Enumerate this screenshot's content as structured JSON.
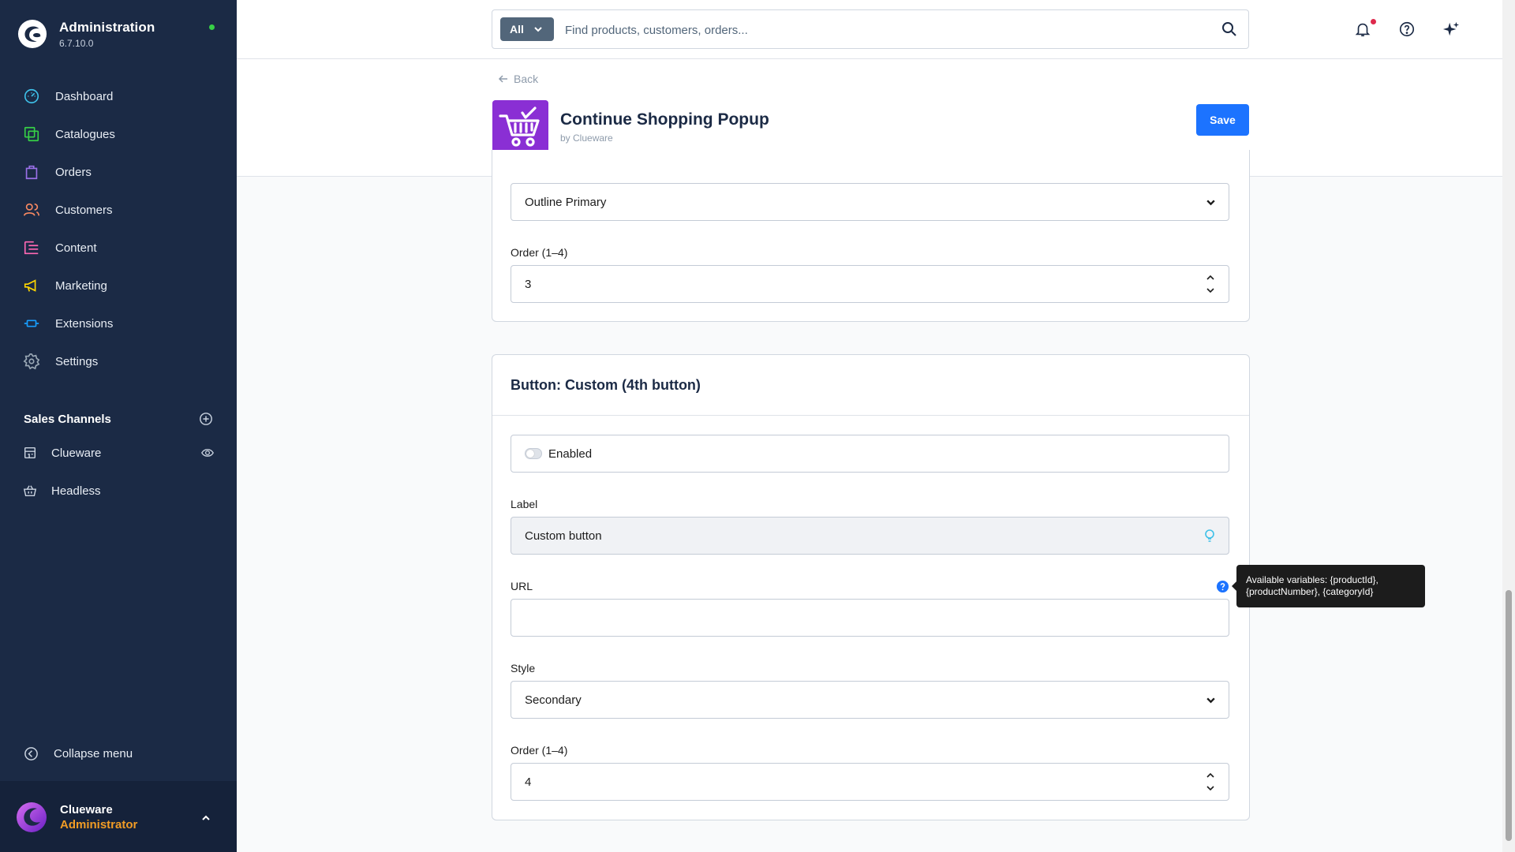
{
  "app": {
    "title": "Administration",
    "version": "6.7.10.0"
  },
  "sidebar": {
    "items": [
      {
        "label": "Dashboard",
        "icon": "dashboard-icon",
        "color": "#3ec0e8"
      },
      {
        "label": "Catalogues",
        "icon": "catalogues-icon",
        "color": "#37d046"
      },
      {
        "label": "Orders",
        "icon": "orders-icon",
        "color": "#9a70e8"
      },
      {
        "label": "Customers",
        "icon": "customers-icon",
        "color": "#f88962"
      },
      {
        "label": "Content",
        "icon": "content-icon",
        "color": "#ff68b4"
      },
      {
        "label": "Marketing",
        "icon": "marketing-icon",
        "color": "#ffd700"
      },
      {
        "label": "Extensions",
        "icon": "extensions-icon",
        "color": "#189eff"
      },
      {
        "label": "Settings",
        "icon": "settings-icon",
        "color": "#9aa8b5"
      }
    ],
    "sales_channels_title": "Sales Channels",
    "sales_channels": [
      {
        "label": "Clueware",
        "icon": "storefront-icon"
      },
      {
        "label": "Headless",
        "icon": "headless-basket-icon"
      }
    ],
    "collapse_label": "Collapse menu",
    "user": {
      "name": "Clueware",
      "role": "Administrator"
    }
  },
  "search": {
    "type_label": "All",
    "placeholder": "Find products, customers, orders..."
  },
  "header": {
    "back_label": "Back",
    "title": "Continue Shopping Popup",
    "by": "by Clueware",
    "save_label": "Save"
  },
  "card1": {
    "style_value": "Outline Primary",
    "order_label": "Order (1–4)",
    "order_value": "3"
  },
  "card2": {
    "title": "Button: Custom (4th button)",
    "enabled_label": "Enabled",
    "enabled": false,
    "label_label": "Label",
    "label_value": "Custom button",
    "url_label": "URL",
    "url_value": "",
    "url_tooltip": "Available variables: {productId}, {productNumber}, {categoryId}",
    "style_label": "Style",
    "style_value": "Secondary",
    "order_label": "Order (1–4)",
    "order_value": "4"
  },
  "colors": {
    "sidebar_bg": "#1b2a45",
    "accent": "#1c73ff",
    "role": "#f19c25",
    "online": "#37d046"
  }
}
